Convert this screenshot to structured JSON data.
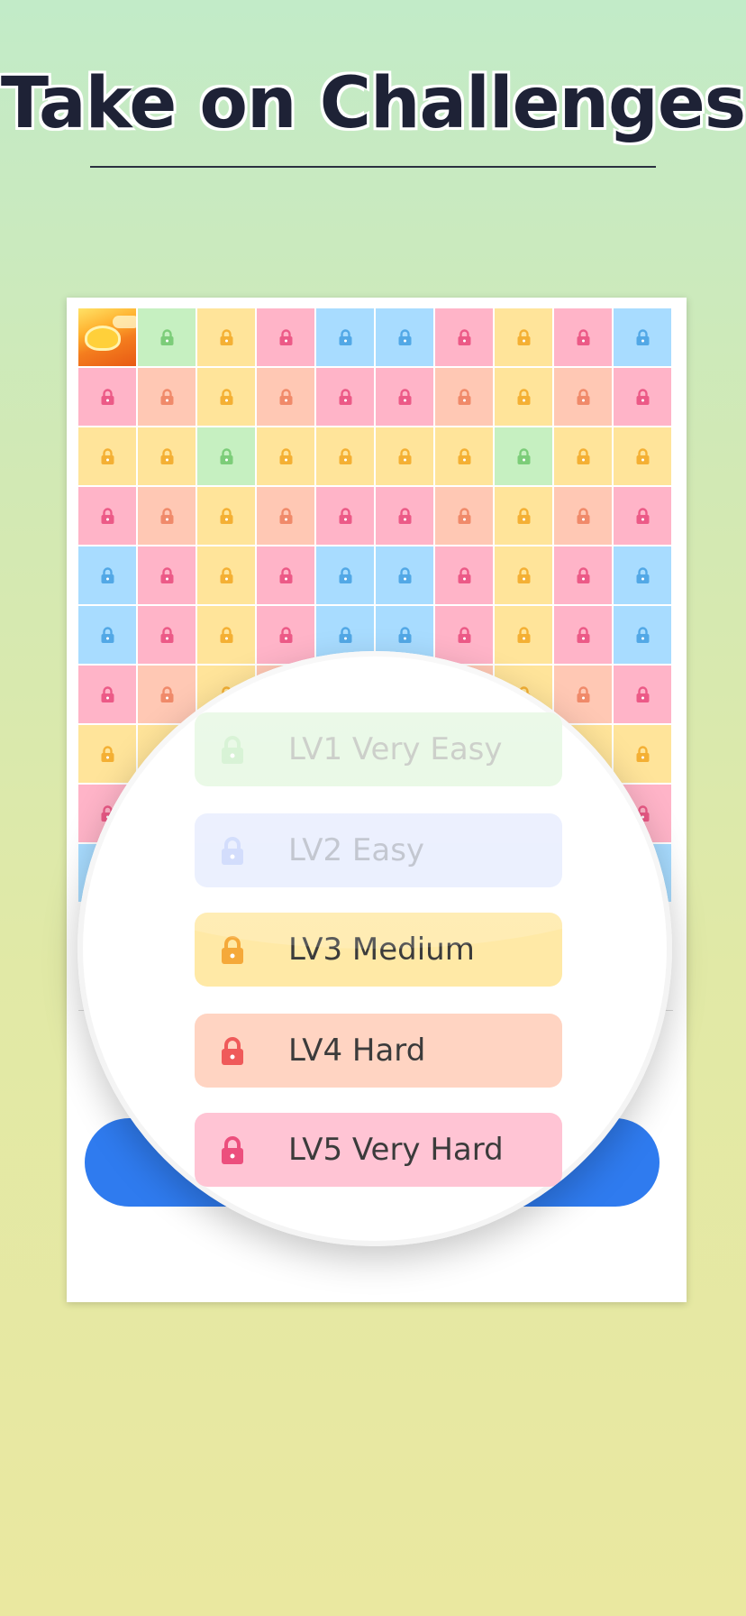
{
  "headline": "Take on Challenges",
  "colors": {
    "green": "#c6f0c1",
    "blue": "#a8dcff",
    "yellow": "#ffe49a",
    "pink": "#ffb4c8",
    "peach": "#ffc8b4",
    "lock_green": "#7ccd79",
    "lock_blue": "#52a8e6",
    "lock_yellow": "#f4b034",
    "lock_pink": "#ec5a87",
    "lock_peach": "#f08a6a",
    "accent_button": "#2f7bef"
  },
  "grid": {
    "rows": [
      [
        "featured",
        "green",
        "yellow",
        "pink",
        "blue",
        "blue",
        "pink",
        "yellow",
        "pink",
        "blue"
      ],
      [
        "pink",
        "peach",
        "yellow",
        "peach",
        "pink",
        "pink",
        "peach",
        "yellow",
        "peach",
        "pink"
      ],
      [
        "yellow",
        "yellow",
        "green",
        "yellow",
        "yellow",
        "yellow",
        "yellow",
        "green",
        "yellow",
        "yellow"
      ],
      [
        "pink",
        "peach",
        "yellow",
        "peach",
        "pink",
        "pink",
        "peach",
        "yellow",
        "peach",
        "pink"
      ],
      [
        "blue",
        "pink",
        "yellow",
        "pink",
        "blue",
        "blue",
        "pink",
        "yellow",
        "pink",
        "blue"
      ],
      [
        "blue",
        "pink",
        "yellow",
        "pink",
        "blue",
        "blue",
        "pink",
        "yellow",
        "pink",
        "blue"
      ],
      [
        "pink",
        "peach",
        "yellow",
        "peach",
        "pink",
        "pink",
        "peach",
        "yellow",
        "peach",
        "pink"
      ],
      [
        "yellow",
        "yellow",
        "green",
        "yellow",
        "yellow",
        "yellow",
        "yellow",
        "green",
        "yellow",
        "yellow"
      ],
      [
        "pink",
        "peach",
        "yellow",
        "peach",
        "pink",
        "pink",
        "peach",
        "yellow",
        "peach",
        "pink"
      ],
      [
        "blue",
        "pink",
        "yellow",
        "pink",
        "blue",
        "blue",
        "pink",
        "yellow",
        "pink",
        "blue"
      ]
    ]
  },
  "levels": [
    {
      "label": "LV1 Very Easy",
      "lock_color": "#c9eec6"
    },
    {
      "label": "LV2 Easy",
      "lock_color": "#c7d4fb"
    },
    {
      "label": "LV3 Medium",
      "lock_color": "#f5a93a"
    },
    {
      "label": "LV4 Hard",
      "lock_color": "#ef5a5a"
    },
    {
      "label": "LV5 Very Hard",
      "lock_color": "#ec4f7d"
    }
  ]
}
